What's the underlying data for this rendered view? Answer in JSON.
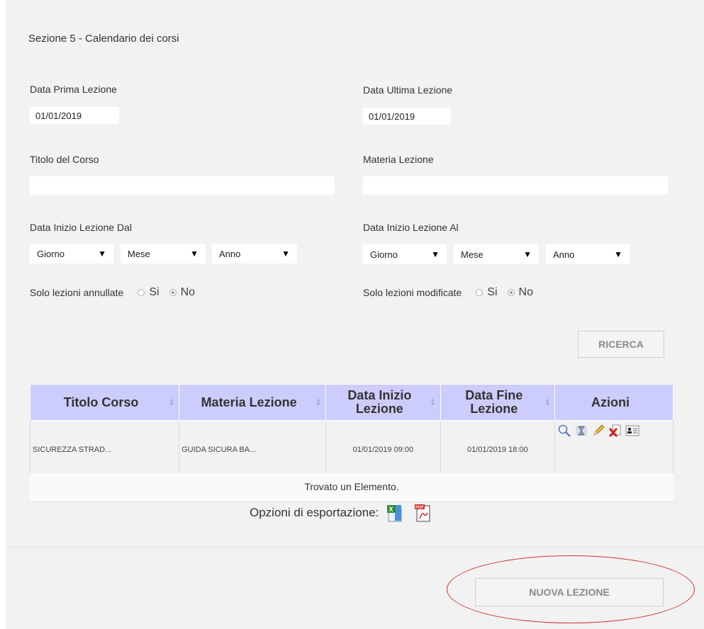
{
  "section": {
    "title": "Sezione 5 - Calendario dei corsi"
  },
  "filters": {
    "data_prima_label": "Data Prima Lezione",
    "data_prima_value": "01/01/2019",
    "data_ultima_label": "Data Ultima Lezione",
    "data_ultima_value": "01/01/2019",
    "titolo_label": "Titolo del Corso",
    "titolo_value": "",
    "materia_label": "Materia Lezione",
    "materia_value": "",
    "dal_label": "Data Inizio Lezione Dal",
    "al_label": "Data Inizio Lezione Al",
    "giorno": "Giorno",
    "mese": "Mese",
    "anno": "Anno",
    "annullate_label": "Solo lezioni annullate",
    "modificate_label": "Solo lezioni modificate",
    "si": "Si",
    "no": "No",
    "annullate_selected": "No",
    "modificate_selected": "No"
  },
  "buttons": {
    "search": "RICERCA",
    "new_lesson": "NUOVA LEZIONE"
  },
  "table": {
    "headers": [
      "Titolo Corso",
      "Materia Lezione",
      "Data Inizio Lezione",
      "Data Fine Lezione",
      "Azioni"
    ],
    "rows": [
      {
        "titolo": "SICUREZZA STRAD...",
        "materia": "GUIDA SICURA BA...",
        "inizio": "01/01/2019 09:00",
        "fine": "01/01/2019 18:00"
      }
    ],
    "action_icons": [
      "search-icon",
      "hourglass-icon",
      "edit-pencil-icon",
      "delete-document-icon",
      "user-card-icon"
    ],
    "footer": "Trovato un Elemento."
  },
  "export": {
    "label": "Opzioni di esportazione:",
    "icons": [
      "excel-icon",
      "pdf-icon"
    ]
  },
  "colors": {
    "header_bg": "#cccdfc",
    "panel_bg": "#f2f2f2",
    "highlight": "#d32f2f"
  }
}
